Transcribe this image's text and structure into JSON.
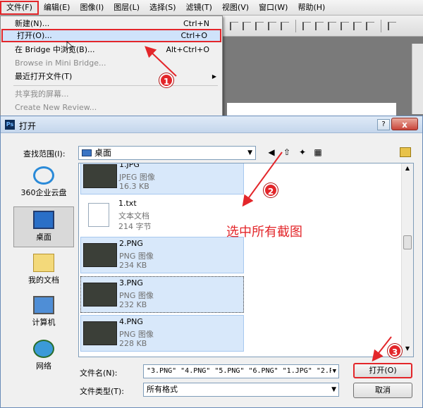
{
  "menubar": {
    "items": [
      "文件(F)",
      "编辑(E)",
      "图像(I)",
      "图层(L)",
      "选择(S)",
      "滤镜(T)",
      "视图(V)",
      "窗口(W)",
      "帮助(H)"
    ]
  },
  "file_menu": {
    "new": {
      "label": "新建(N)...",
      "shortcut": "Ctrl+N"
    },
    "open": {
      "label": "打开(O)...",
      "shortcut": "Ctrl+O"
    },
    "bridge": {
      "label": "在 Bridge 中浏览(B)...",
      "shortcut": "Alt+Ctrl+O"
    },
    "mini_bridge": {
      "label": "Browse in Mini Bridge..."
    },
    "recent": {
      "label": "最近打开文件(T)"
    },
    "share_screen": {
      "label": "共享我的屏幕..."
    },
    "new_review": {
      "label": "Create New Review..."
    }
  },
  "dialog": {
    "title": "打开",
    "app_icon": "Ps",
    "help_button": "?",
    "close_button": "x",
    "lookin_label": "查找范围(I):",
    "lookin_value": "桌面",
    "places": [
      {
        "label": "360企业云盘",
        "icon": "cloud-icon"
      },
      {
        "label": "桌面",
        "icon": "desktop-icon"
      },
      {
        "label": "我的文档",
        "icon": "documents-icon"
      },
      {
        "label": "计算机",
        "icon": "computer-icon"
      },
      {
        "label": "网络",
        "icon": "network-icon"
      }
    ],
    "files": [
      {
        "name": "1.JPG",
        "type": "JPEG 图像",
        "size": "16.3 KB"
      },
      {
        "name": "1.txt",
        "type": "文本文档",
        "size": "214 字节"
      },
      {
        "name": "2.PNG",
        "type": "PNG 图像",
        "size": "234 KB"
      },
      {
        "name": "3.PNG",
        "type": "PNG 图像",
        "size": "232 KB"
      },
      {
        "name": "4.PNG",
        "type": "PNG 图像",
        "size": "228 KB"
      }
    ],
    "filename_label": "文件名(N):",
    "filename_value": "\"3.PNG\" \"4.PNG\" \"5.PNG\" \"6.PNG\" \"1.JPG\" \"2.P",
    "filetype_label": "文件类型(T):",
    "filetype_value": "所有格式",
    "open_button": "打开(O)",
    "cancel_button": "取消"
  },
  "annotations": {
    "step1": "1",
    "step2": "2",
    "step3": "3",
    "note": "选中所有截图",
    "color": "#e3262a"
  }
}
